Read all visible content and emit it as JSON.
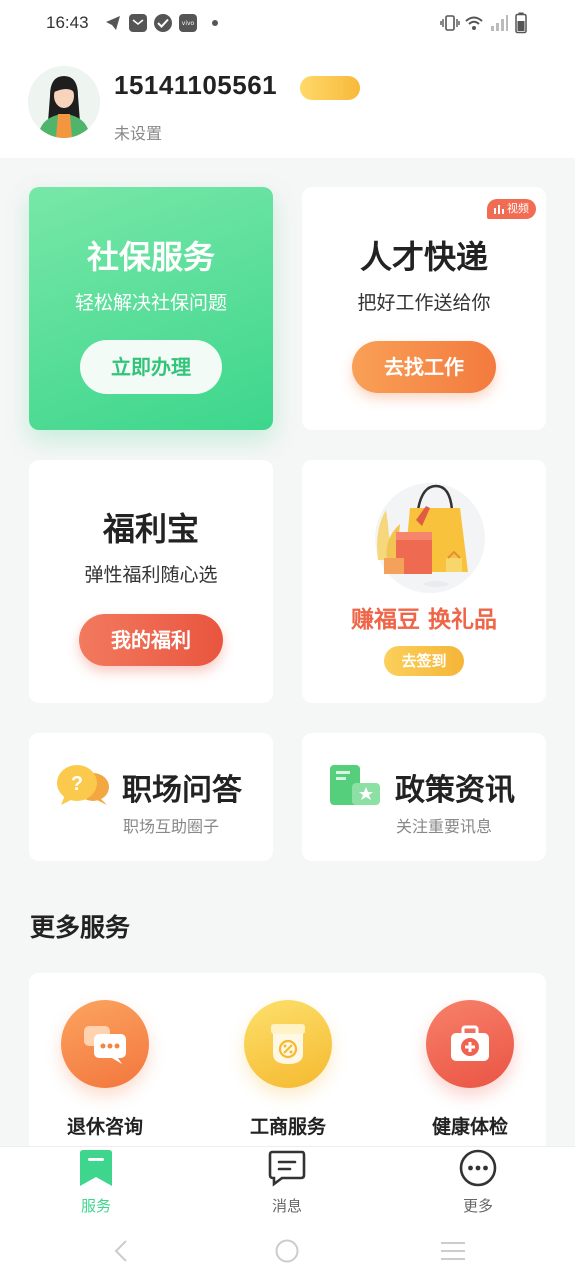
{
  "status_bar": {
    "time": "16:43",
    "brand_badge": "vivo"
  },
  "profile": {
    "phone": "15141105561",
    "nickname": "未设置"
  },
  "cards": {
    "social_security": {
      "title": "社保服务",
      "subtitle": "轻松解决社保问题",
      "button": "立即办理"
    },
    "talent_delivery": {
      "title": "人才快递",
      "subtitle": "把好工作送给你",
      "button": "去找工作",
      "tag": "视频"
    },
    "welfare": {
      "title": "福利宝",
      "subtitle": "弹性福利随心选",
      "button": "我的福利"
    },
    "points": {
      "title": "赚福豆 换礼品",
      "button": "去签到"
    },
    "workplace_qa": {
      "title": "职场问答",
      "subtitle": "职场互助圈子"
    },
    "policy_news": {
      "title": "政策资讯",
      "subtitle": "关注重要讯息"
    }
  },
  "more_services": {
    "title": "更多服务",
    "items": [
      {
        "label": "退休咨询",
        "icon": "chat-bubbles-icon"
      },
      {
        "label": "工商服务",
        "icon": "percent-tag-icon"
      },
      {
        "label": "健康体检",
        "icon": "medical-kit-icon"
      }
    ]
  },
  "tabbar": {
    "items": [
      {
        "label": "服务",
        "icon": "bookmark-icon",
        "active": true
      },
      {
        "label": "消息",
        "icon": "message-icon",
        "active": false
      },
      {
        "label": "更多",
        "icon": "more-icon",
        "active": false
      }
    ]
  },
  "colors": {
    "green": "#3dd68c",
    "orange": "#f7894a",
    "red": "#f0604e",
    "yellow": "#f7c23e"
  }
}
